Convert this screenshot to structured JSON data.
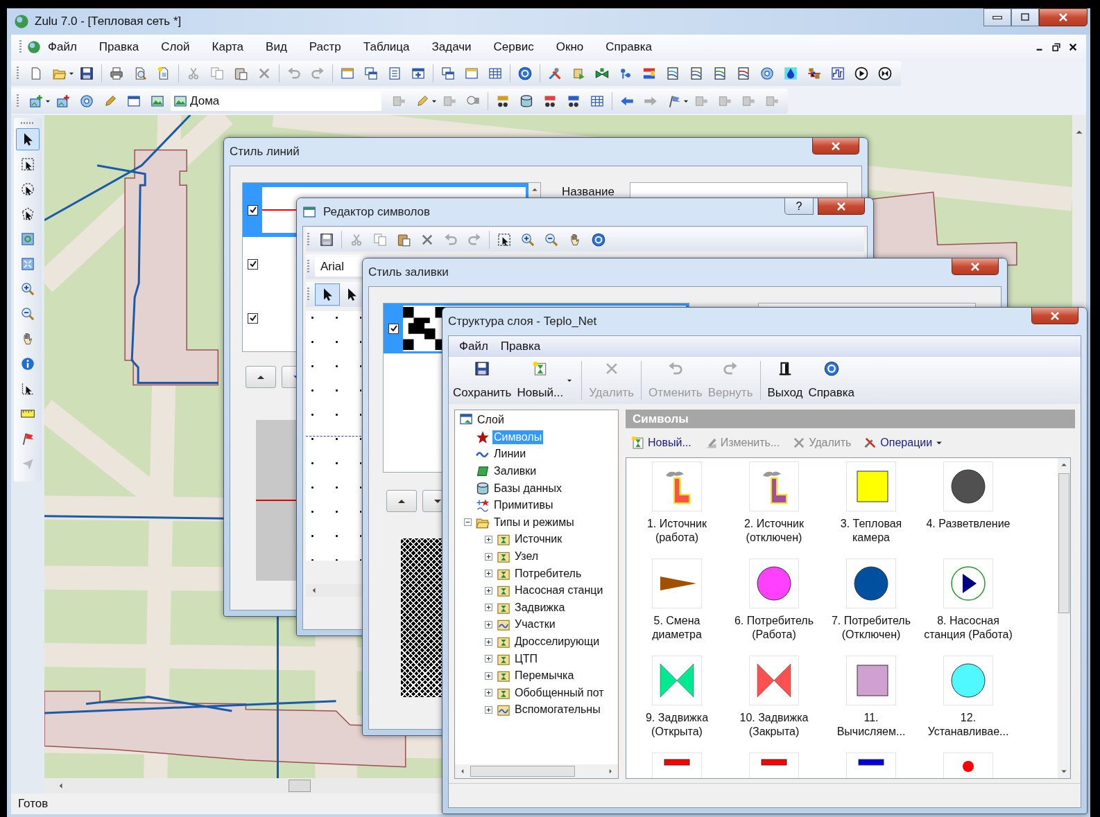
{
  "window": {
    "title": "Zulu 7.0 - [Тепловая сеть *]"
  },
  "menu": [
    "Файл",
    "Правка",
    "Слой",
    "Карта",
    "Вид",
    "Растр",
    "Таблица",
    "Задачи",
    "Сервис",
    "Окно",
    "Справка"
  ],
  "layer_combo": {
    "value": "Дома"
  },
  "map_tools": [
    {
      "selected": true
    },
    {
      "selected": false
    },
    {
      "selected": false
    },
    {
      "selected": false
    },
    {
      "selected": false
    },
    {
      "selected": false
    },
    {
      "selected": false
    },
    {
      "selected": false
    },
    {
      "selected": false
    },
    {
      "selected": false
    },
    {
      "selected": false
    },
    {
      "selected": false
    },
    {
      "selected": false
    },
    {
      "selected": false
    }
  ],
  "status_bar": "Готов",
  "line_style_dialog": {
    "title": "Стиль линий",
    "rows": [
      {
        "checked": true,
        "selected": true,
        "color": "#ff0000"
      },
      {
        "checked": true,
        "selected": false
      },
      {
        "checked": true,
        "selected": false
      }
    ],
    "name_label": "Название"
  },
  "symbol_editor": {
    "title": "Редактор символов",
    "help_button": "?",
    "font": "Arial"
  },
  "fill_style_dialog": {
    "title": "Стиль заливки",
    "rows": [
      {
        "checked": true,
        "selected": true
      }
    ]
  },
  "layer_structure": {
    "title": "Структура слоя - Teplo_Net",
    "menu": [
      "Файл",
      "Правка"
    ],
    "toolbar": [
      {
        "label": "Сохранить",
        "disabled": false
      },
      {
        "label": "Новый...",
        "disabled": false
      },
      {
        "label": "Удалить",
        "disabled": true
      },
      {
        "label": "Отменить",
        "disabled": true
      },
      {
        "label": "Вернуть",
        "disabled": true
      },
      {
        "label": "Выход",
        "disabled": false
      },
      {
        "label": "Справка",
        "disabled": false
      }
    ],
    "tree": [
      {
        "label": "Слой",
        "kind": "layer",
        "selected": false,
        "children": [
          {
            "label": "Символы",
            "kind": "symbols",
            "selected": true
          },
          {
            "label": "Линии",
            "kind": "lines",
            "selected": false
          },
          {
            "label": "Заливки",
            "kind": "fills",
            "selected": false
          },
          {
            "label": "Базы данных",
            "kind": "databases",
            "selected": false
          },
          {
            "label": "Примитивы",
            "kind": "primitives",
            "selected": false
          },
          {
            "label": "Типы и режимы",
            "kind": "folder",
            "selected": false,
            "expanded": true,
            "children": [
              {
                "label": "Источник",
                "kind": "type",
                "selected": false,
                "expanded": false
              },
              {
                "label": "Узел",
                "kind": "type",
                "selected": false,
                "expanded": false
              },
              {
                "label": "Потребитель",
                "kind": "type",
                "selected": false,
                "expanded": false
              },
              {
                "label": "Насосная станци",
                "kind": "type",
                "selected": false,
                "expanded": false
              },
              {
                "label": "Задвижка",
                "kind": "type",
                "selected": false,
                "expanded": false
              },
              {
                "label": "Участки",
                "kind": "linetype",
                "selected": false,
                "expanded": false
              },
              {
                "label": "Дросселирующи",
                "kind": "type",
                "selected": false,
                "expanded": false
              },
              {
                "label": "ЦТП",
                "kind": "type",
                "selected": false,
                "expanded": false
              },
              {
                "label": "Перемычка",
                "kind": "type",
                "selected": false,
                "expanded": false
              },
              {
                "label": "Обобщенный пот",
                "kind": "type",
                "selected": false,
                "expanded": false
              },
              {
                "label": "Вспомогательны",
                "kind": "linetype",
                "selected": false,
                "expanded": false
              }
            ]
          }
        ]
      }
    ],
    "panel_title": "Символы",
    "panel_actions": [
      {
        "label": "Новый...",
        "disabled": false,
        "kind": "new"
      },
      {
        "label": "Изменить...",
        "disabled": true,
        "kind": "edit"
      },
      {
        "label": "Удалить",
        "disabled": true,
        "kind": "delete"
      },
      {
        "label": "Операции",
        "disabled": false,
        "kind": "operations"
      }
    ],
    "symbols": [
      {
        "kind": "source",
        "color": "#ff5050",
        "lines": [
          "1. Источник",
          "(работа)"
        ]
      },
      {
        "kind": "source",
        "color": "#a050a0",
        "lines": [
          "2. Источник",
          "(отключен)"
        ]
      },
      {
        "kind": "square",
        "color": "#ffff00",
        "lines": [
          "3. Тепловая",
          "камера"
        ]
      },
      {
        "kind": "circle",
        "color": "#505050",
        "lines": [
          "4. Разветвление"
        ]
      },
      {
        "kind": "triangle",
        "color": "#a05000",
        "lines": [
          "5. Смена",
          "диаметра"
        ]
      },
      {
        "kind": "circle",
        "color": "#ff40ff",
        "lines": [
          "6. Потребитель",
          "(Работа)"
        ]
      },
      {
        "kind": "circle",
        "color": "#0050a0",
        "lines": [
          "7. Потребитель",
          "(Отключен)"
        ]
      },
      {
        "kind": "pump",
        "color": "#000080",
        "lines": [
          "8. Насосная",
          "станция (Работа)"
        ]
      },
      {
        "kind": "valve",
        "color": "#00e890",
        "lines": [
          "9. Задвижка",
          "(Открыта)"
        ]
      },
      {
        "kind": "valve",
        "color": "#ff5050",
        "lines": [
          "10. Задвижка",
          "(Закрыта)"
        ]
      },
      {
        "kind": "square",
        "color": "#d0a0d0",
        "lines": [
          "11.",
          "Вычисляем..."
        ]
      },
      {
        "kind": "circle",
        "color": "#50f8ff",
        "lines": [
          "12.",
          "Устанавливае..."
        ]
      },
      {
        "kind": "bar",
        "color": "#ff0000"
      },
      {
        "kind": "bar",
        "color": "#ff0000"
      },
      {
        "kind": "bar",
        "color": "#0000e0"
      },
      {
        "kind": "dot",
        "color": "#ff0000"
      }
    ]
  }
}
